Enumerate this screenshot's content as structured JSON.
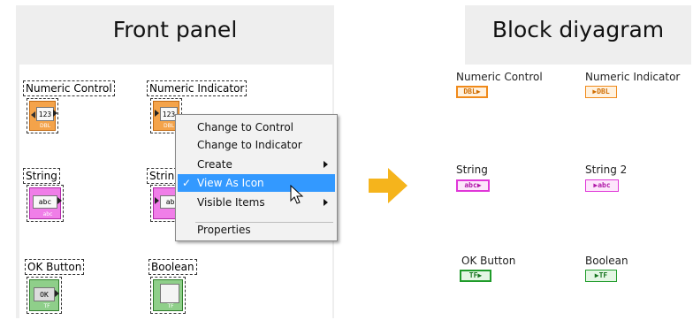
{
  "front_panel": {
    "title": "Front panel",
    "controls": {
      "numeric_control": {
        "label": "Numeric Control",
        "value": "123",
        "type": "DBL"
      },
      "numeric_indicator": {
        "label": "Numeric Indicator",
        "value": "123",
        "type": "DBL"
      },
      "string": {
        "label": "String",
        "value": "abc",
        "type": "abc"
      },
      "string2_label_partial": "Strin",
      "string2_value": "abc",
      "ok_button": {
        "label": "OK Button",
        "text": "OK",
        "type": "TF"
      },
      "boolean": {
        "label": "Boolean",
        "type": "TF"
      }
    }
  },
  "context_menu": {
    "items": [
      {
        "label": "Change to Control"
      },
      {
        "label": "Change to Indicator"
      },
      {
        "label": "Create"
      },
      {
        "label": "View As Icon",
        "checked": true
      },
      {
        "label": "Visible Items"
      },
      {
        "label": "Properties"
      }
    ],
    "check_glyph": "✓",
    "selection_color": "#3399ff"
  },
  "block_diagram": {
    "title": "Block diyagram",
    "terminals": {
      "numeric_control": {
        "label": "Numeric Control",
        "type": "DBL"
      },
      "numeric_indicator": {
        "label": "Numeric Indicator",
        "type": "DBL"
      },
      "string": {
        "label": "String",
        "type": "abc"
      },
      "string2": {
        "label": "String 2",
        "type": "abc"
      },
      "ok_button": {
        "label": "OK Button",
        "type": "TF"
      },
      "boolean": {
        "label": "Boolean",
        "type": "TF"
      }
    }
  },
  "colors": {
    "numeric": "#f08a1a",
    "string": "#e037d8",
    "boolean": "#1f9b2a",
    "arrow": "#f5b41c"
  }
}
